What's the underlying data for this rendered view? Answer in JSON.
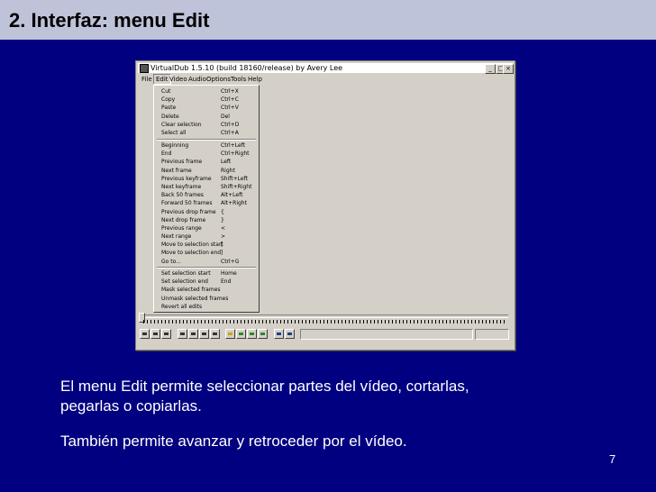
{
  "slide": {
    "title": "2. Interfaz: menu Edit",
    "paragraph1_line1": "El menu Edit permite seleccionar partes del vídeo, cortarlas,",
    "paragraph1_line2": "pegarlas o copiarlas.",
    "paragraph2": "También permite avanzar y retroceder por el vídeo.",
    "page_number": "7"
  },
  "colors": {
    "background": "#000080",
    "title_bar": "#bfc3d9",
    "window_face": "#d4d0c8"
  },
  "app": {
    "window_title": "VirtualDub 1.5.10 (build 18160/release) by Avery Lee",
    "controls": {
      "minimize": "_",
      "maximize": "□",
      "close": "×"
    },
    "menus": [
      "File",
      "Edit",
      "Video",
      "Audio",
      "Options",
      "Tools",
      "Help"
    ],
    "edit_menu": {
      "group1": [
        {
          "label": "Cut",
          "shortcut": "Ctrl+X"
        },
        {
          "label": "Copy",
          "shortcut": "Ctrl+C"
        },
        {
          "label": "Paste",
          "shortcut": "Ctrl+V"
        },
        {
          "label": "Delete",
          "shortcut": "Del"
        },
        {
          "label": "Clear selection",
          "shortcut": "Ctrl+D"
        },
        {
          "label": "Select all",
          "shortcut": "Ctrl+A"
        }
      ],
      "group2": [
        {
          "label": "Beginning",
          "shortcut": "Ctrl+Left"
        },
        {
          "label": "End",
          "shortcut": "Ctrl+Right"
        },
        {
          "label": "Previous frame",
          "shortcut": "Left"
        },
        {
          "label": "Next frame",
          "shortcut": "Right"
        },
        {
          "label": "Previous keyframe",
          "shortcut": "Shift+Left"
        },
        {
          "label": "Next keyframe",
          "shortcut": "Shift+Right"
        },
        {
          "label": "Back 50 frames",
          "shortcut": "Alt+Left"
        },
        {
          "label": "Forward 50 frames",
          "shortcut": "Alt+Right"
        },
        {
          "label": "Previous drop frame",
          "shortcut": "{"
        },
        {
          "label": "Next drop frame",
          "shortcut": "}"
        },
        {
          "label": "Previous range",
          "shortcut": "<"
        },
        {
          "label": "Next range",
          "shortcut": ">"
        },
        {
          "label": "Move to selection start",
          "shortcut": "["
        },
        {
          "label": "Move to selection end",
          "shortcut": "]"
        },
        {
          "label": "Go to...",
          "shortcut": "Ctrl+G"
        }
      ],
      "group3": [
        {
          "label": "Set selection start",
          "shortcut": "Home"
        },
        {
          "label": "Set selection end",
          "shortcut": "End"
        },
        {
          "label": "Mask selected frames",
          "shortcut": ""
        },
        {
          "label": "Unmask selected frames",
          "shortcut": ""
        },
        {
          "label": "Revert all edits",
          "shortcut": ""
        }
      ]
    },
    "toolbar_icons": [
      "stop-icon",
      "play-input-icon",
      "play-output-icon",
      "start-icon",
      "back-icon",
      "forward-icon",
      "end-icon",
      "prev-key-icon",
      "next-key-icon",
      "scene-back-icon",
      "scene-forward-icon",
      "mark-in-icon",
      "mark-out-icon"
    ]
  }
}
